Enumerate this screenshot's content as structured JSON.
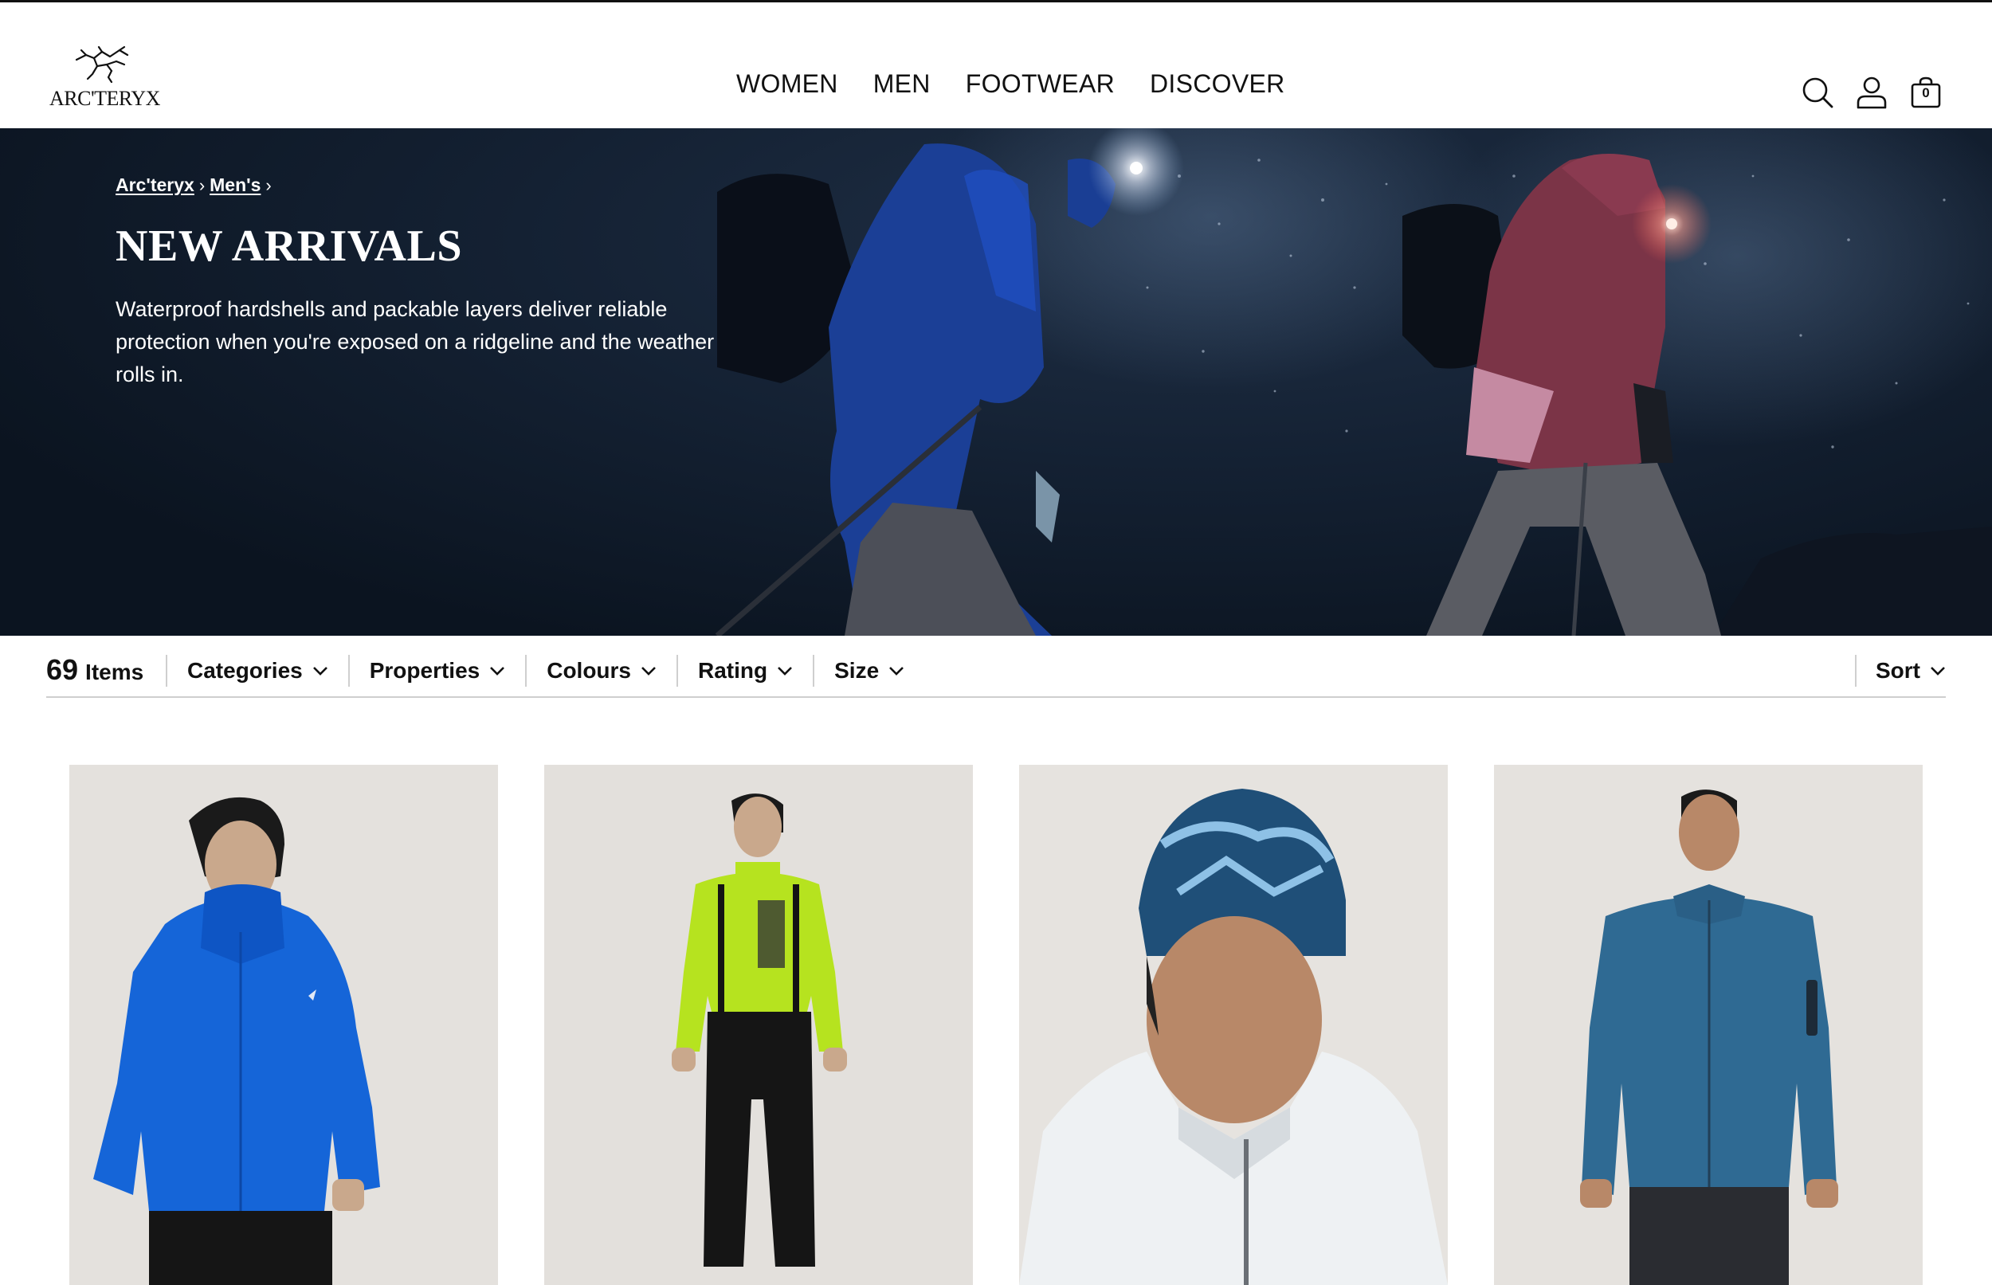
{
  "brand": {
    "name": "ARC'TERYX"
  },
  "nav": {
    "items": [
      "WOMEN",
      "MEN",
      "FOOTWEAR",
      "DISCOVER"
    ]
  },
  "header": {
    "bag_count": "0",
    "icons": [
      "search-icon",
      "account-icon",
      "bag-icon"
    ]
  },
  "hero": {
    "breadcrumb": [
      "Arc'teryx",
      "Men's"
    ],
    "title": "NEW ARRIVALS",
    "description": "Waterproof hardshells and packable layers deliver reliable protection when you're exposed on a ridgeline and the weather rolls in."
  },
  "filter_bar": {
    "count": "69",
    "count_label": "Items",
    "filters": [
      "Categories",
      "Properties",
      "Colours",
      "Rating",
      "Size"
    ],
    "sort_label": "Sort"
  },
  "products": [
    {
      "image": "man-blue-hardshell-jacket",
      "color": "#1565d8"
    },
    {
      "image": "man-lime-top-black-bib-pants",
      "color": "#b6e31f"
    },
    {
      "image": "man-blue-beanie-white-jacket",
      "color": "#1f4f78"
    },
    {
      "image": "man-blue-fleece-jacket",
      "color": "#2f6a93"
    }
  ],
  "colors": {
    "text": "#111111",
    "hero_bg": "#0f1a28",
    "divider": "#cfcfcf",
    "card_bg": "#e6e2de"
  }
}
